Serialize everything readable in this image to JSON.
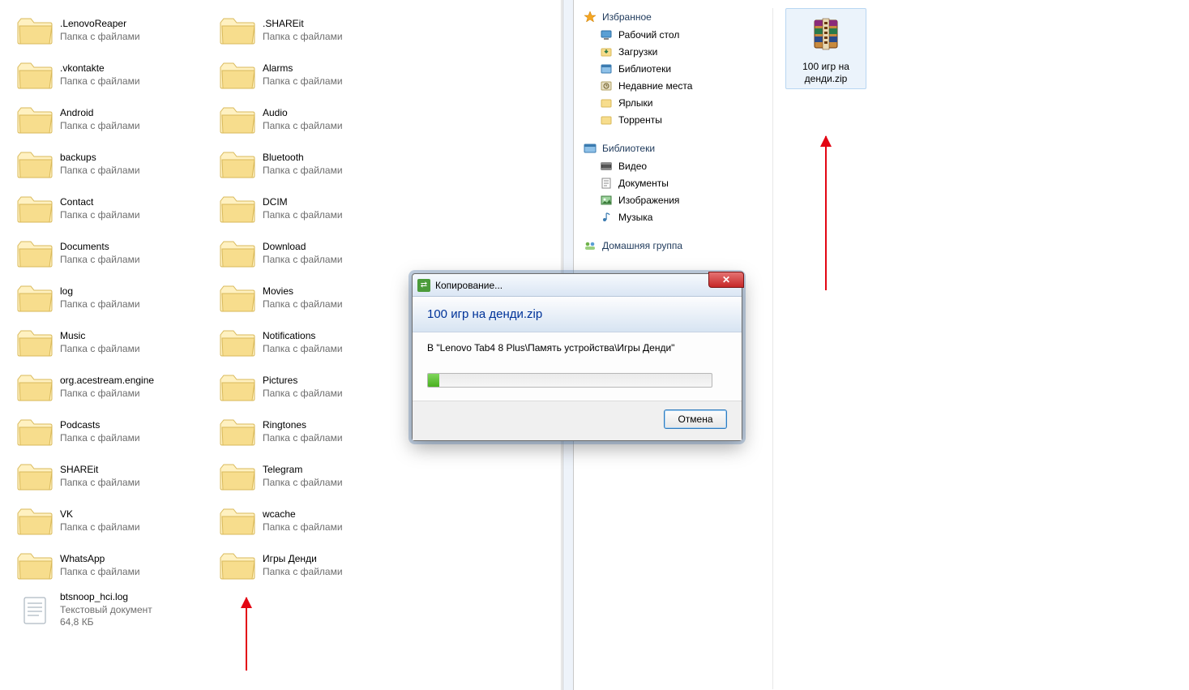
{
  "left": {
    "folder_type": "Папка с файлами",
    "cols": [
      [
        {
          "name": ".LenovoReaper"
        },
        {
          "name": ".vkontakte"
        },
        {
          "name": "Android"
        },
        {
          "name": "backups"
        },
        {
          "name": "Contact"
        },
        {
          "name": "Documents"
        },
        {
          "name": "log"
        },
        {
          "name": "Music"
        },
        {
          "name": "org.acestream.engine"
        },
        {
          "name": "Podcasts"
        },
        {
          "name": "SHAREit"
        },
        {
          "name": "VK"
        },
        {
          "name": "WhatsApp"
        }
      ],
      [
        {
          "name": ".SHAREit"
        },
        {
          "name": "Alarms"
        },
        {
          "name": "Audio"
        },
        {
          "name": "Bluetooth"
        },
        {
          "name": "DCIM"
        },
        {
          "name": "Download"
        },
        {
          "name": "Movies"
        },
        {
          "name": "Notifications"
        },
        {
          "name": "Pictures"
        },
        {
          "name": "Ringtones"
        },
        {
          "name": "Telegram"
        },
        {
          "name": "wcache"
        },
        {
          "name": "Игры Денди"
        }
      ]
    ],
    "textfile": {
      "name": "btsnoop_hci.log",
      "type": "Текстовый документ",
      "size": "64,8 КБ"
    }
  },
  "tree": {
    "favorites": {
      "label": "Избранное",
      "items": [
        "Рабочий стол",
        "Загрузки",
        "Библиотеки",
        "Недавние места",
        "Ярлыки",
        "Торренты"
      ]
    },
    "libraries": {
      "label": "Библиотеки",
      "items": [
        "Видео",
        "Документы",
        "Изображения",
        "Музыка"
      ]
    },
    "homegroup": {
      "label": "Домашняя группа"
    }
  },
  "zip": {
    "name": "100 игр на денди.zip"
  },
  "dialog": {
    "title": "Копирование...",
    "heading": "100 игр на денди.zip",
    "dest": "В \"Lenovo Tab4 8 Plus\\Память устройства\\Игры Денди\"",
    "cancel": "Отмена",
    "progress_pct": 4
  }
}
